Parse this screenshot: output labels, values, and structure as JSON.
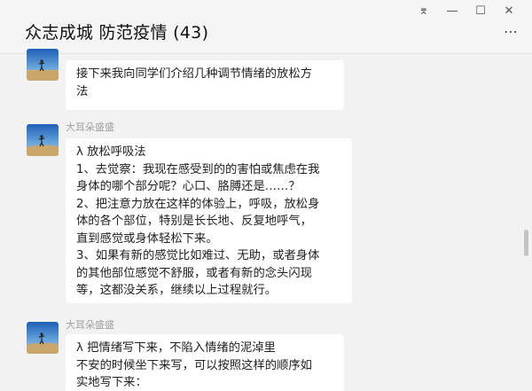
{
  "window": {
    "title": "众志成城 防范疫情 (43)",
    "controls": {
      "pin": "⌆",
      "minimize": "—",
      "maximize": "☐",
      "close": "✕"
    },
    "more_icon": "⋯"
  },
  "messages": [
    {
      "sender": "",
      "lines": [
        "接下来我向同学们介绍几种调节情绪的放松方",
        "法"
      ]
    },
    {
      "sender": "大耳朵盛盛",
      "lines": [
        "λ 放松呼吸法",
        "1、去觉察：我现在感受到的的害怕或焦虑在我",
        "身体的哪个部分呢？心口、胳膊还是……？",
        "2、把注意力放在这样的体验上，呼吸，放松身",
        "体的各个部位，特别是长长地、反复地呼气，",
        "直到感觉或身体轻松下来。",
        "3、如果有新的感觉比如难过、无助，或者身体",
        "的其他部位感觉不舒服，或者有新的念头闪现",
        "等，这都没关系，继续以上过程就行。"
      ]
    },
    {
      "sender": "大耳朵盛盛",
      "lines": [
        "λ 把情绪写下来，不陷入情绪的泥淖里",
        "不安的时候坐下来写，可以按照这样的顺序如",
        "实地写下来："
      ]
    }
  ],
  "colors": {
    "background": "#f2f2f2",
    "bubble": "#ffffff",
    "sender_name": "#a0a0a0",
    "title_text": "#111111"
  }
}
